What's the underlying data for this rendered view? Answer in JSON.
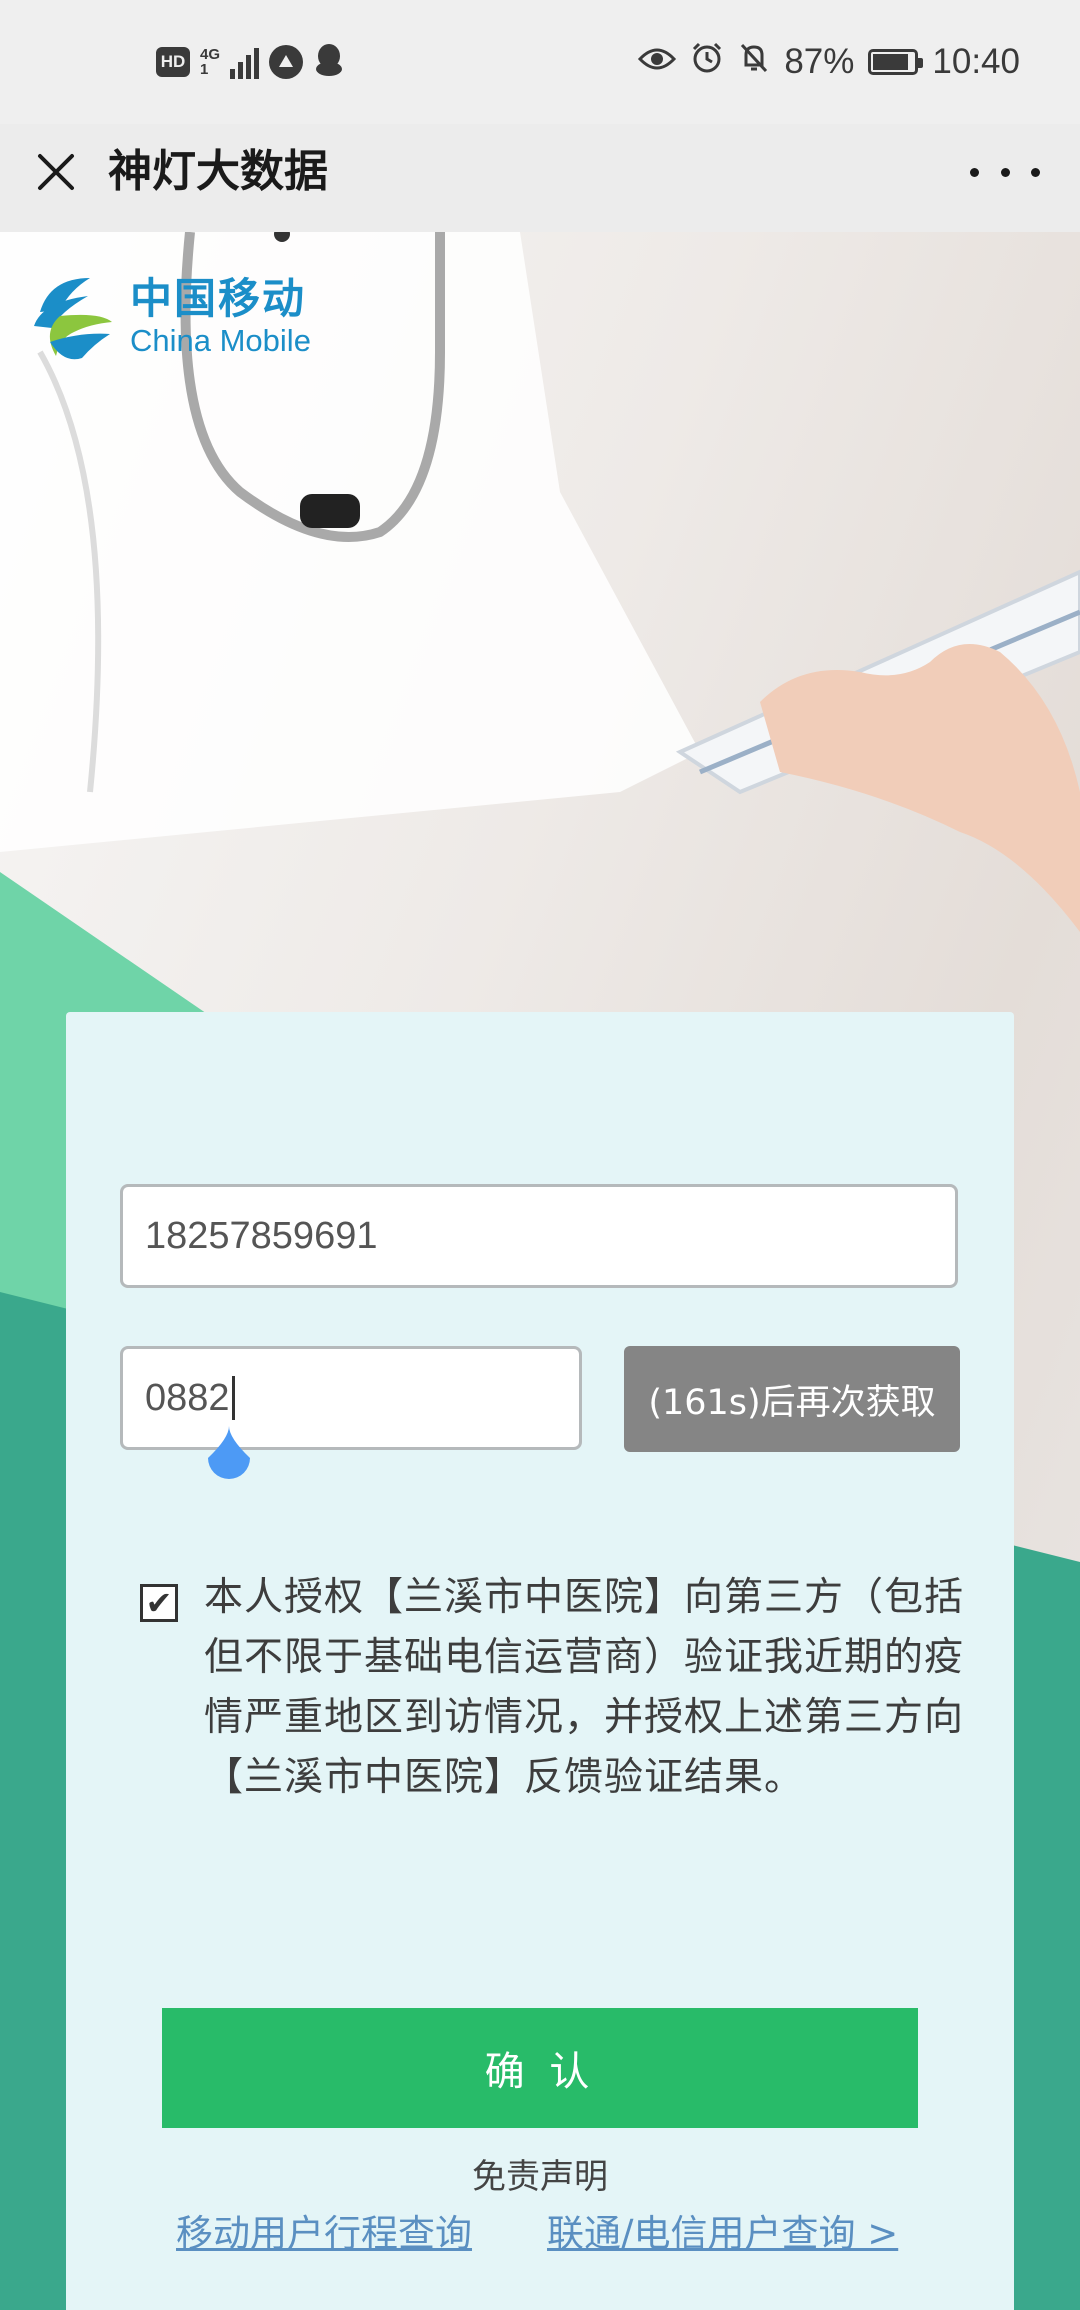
{
  "status_bar": {
    "hd": "HD",
    "net_top": "4G",
    "net_bottom": "1",
    "battery_percent": "87%",
    "battery_level": 0.87,
    "time": "10:40",
    "icons": [
      "hd-icon",
      "signal-icon",
      "app-icon",
      "qq-icon",
      "eye-icon",
      "alarm-icon",
      "mute-icon",
      "battery-icon"
    ]
  },
  "titlebar": {
    "title": "神灯大数据"
  },
  "brand": {
    "cn": "中国移动",
    "en": "China Mobile"
  },
  "form": {
    "phone_value": "18257859691",
    "code_value": "0882",
    "resend_label": "(161s)后再次获取",
    "auth_checked": true,
    "auth_text": "本人授权【兰溪市中医院】向第三方（包括但不限于基础电信运营商）验证我近期的疫情严重地区到访情况，并授权上述第三方向【兰溪市中医院】反馈验证结果。",
    "confirm_label": "确 认",
    "disclaimer": "免责声明",
    "link_mobile": "移动用户行程查询",
    "link_unicom": "联通/电信用户查询 >"
  },
  "colors": {
    "confirm": "#28bb69",
    "card": "#e4f5f7",
    "teal": "#3aa88c",
    "link": "#5a8fc1",
    "resend": "#858585",
    "brand": "#1b8ec8"
  }
}
